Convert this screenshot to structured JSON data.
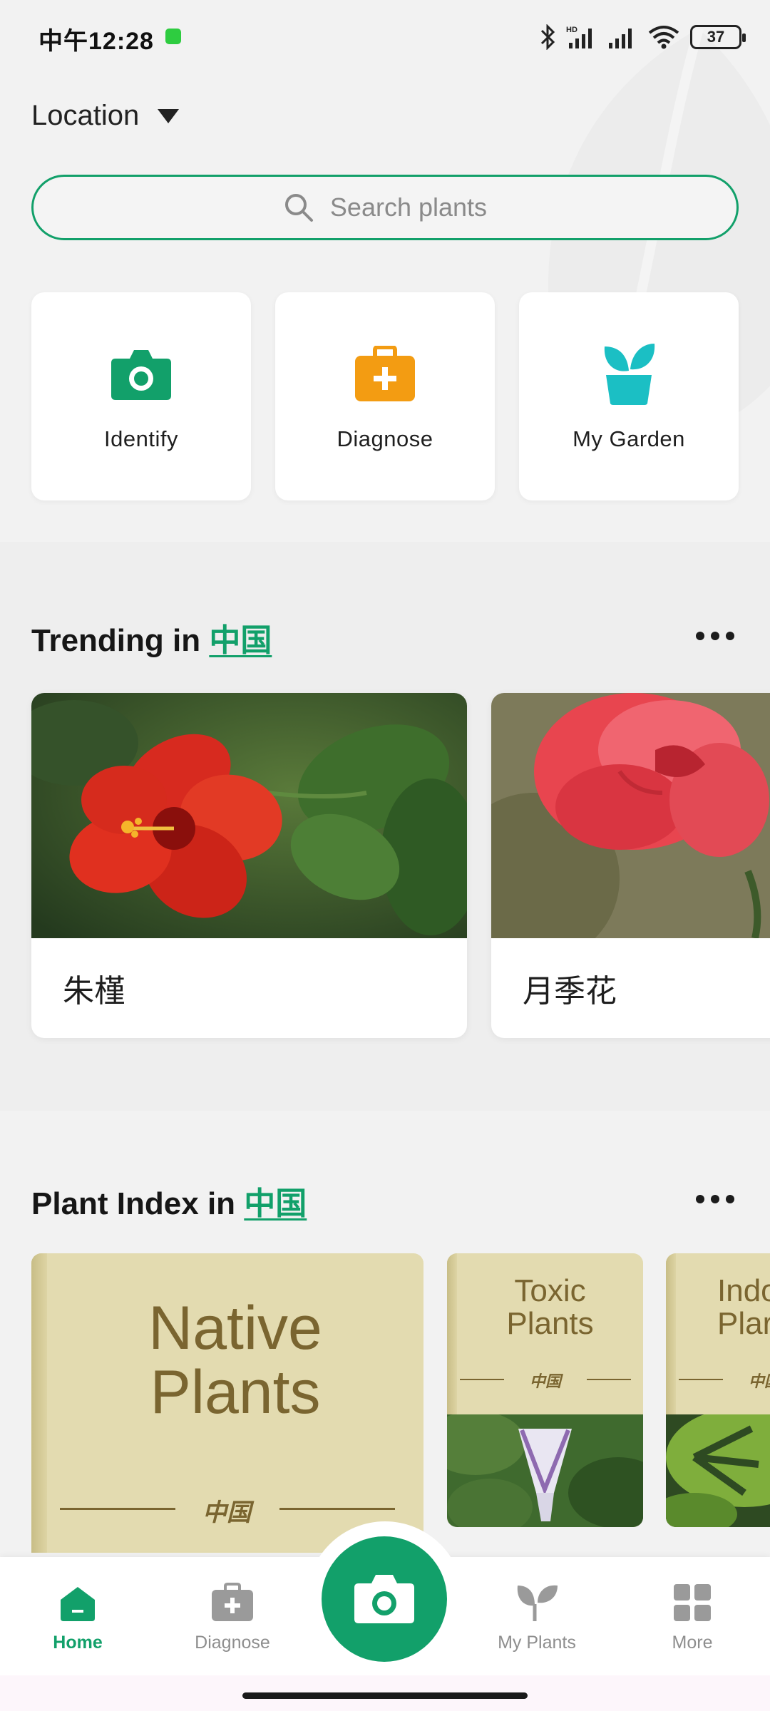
{
  "status_bar": {
    "time": "中午12:28",
    "battery": "37"
  },
  "header": {
    "location_label": "Location"
  },
  "search": {
    "placeholder": "Search plants"
  },
  "quick_actions": [
    {
      "label": "Identify",
      "icon": "camera-icon",
      "color": "#12a06a"
    },
    {
      "label": "Diagnose",
      "icon": "medkit-icon",
      "color": "#f39c12"
    },
    {
      "label": "My Garden",
      "icon": "sprout-pot-icon",
      "color": "#1bbfc4"
    }
  ],
  "trending": {
    "title_prefix": "Trending in ",
    "region": "中国",
    "items": [
      {
        "name": "朱槿"
      },
      {
        "name": "月季花"
      }
    ]
  },
  "plant_index": {
    "title_prefix": "Plant Index in ",
    "region": "中国",
    "books": [
      {
        "title_line1": "Native",
        "title_line2": "Plants",
        "region": "中国"
      },
      {
        "title_line1": "Toxic",
        "title_line2": "Plants",
        "region": "中国"
      },
      {
        "title_line1": "Indo",
        "title_line2": "Plar",
        "region": "中国"
      }
    ]
  },
  "bottom_nav": {
    "home": "Home",
    "diagnose": "Diagnose",
    "my_plants": "My Plants",
    "more": "More"
  },
  "colors": {
    "accent": "#12a06a",
    "book": "#e3dbb0",
    "book_text": "#7a6530"
  }
}
